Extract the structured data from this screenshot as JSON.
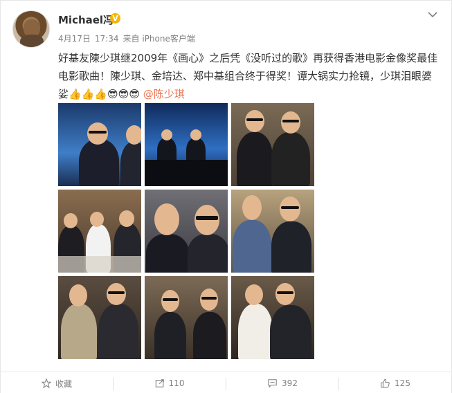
{
  "user": {
    "name": "Michael冯",
    "badge": "V"
  },
  "meta": {
    "date": "4月17日",
    "time": "17:34",
    "source": "来自 iPhone客户端"
  },
  "post": {
    "line1": "好基友陳少琪继2009年《画心》之后凭《没听过的歌》再获得香港电影金像奖最佳",
    "line2": "电影歌曲！陳少琪、金培达、郑中基组合终于得奖！谭大锅实力抢镜，少琪泪眼婆",
    "line3_prefix": "娑",
    "mention": "@陈少琪"
  },
  "photos": [
    {
      "scene": "stage-blue"
    },
    {
      "scene": "stage-screen"
    },
    {
      "scene": "award-two"
    },
    {
      "scene": "dinner-group"
    },
    {
      "scene": "closeup-two"
    },
    {
      "scene": "wall-two"
    },
    {
      "scene": "woman-man"
    },
    {
      "scene": "party-group"
    },
    {
      "scene": "hug"
    }
  ],
  "footer": {
    "favorite_label": "收藏",
    "repost_count": "110",
    "comment_count": "392",
    "like_count": "125"
  },
  "icons": [
    "star-icon",
    "repost-icon",
    "comment-icon",
    "thumb-up-icon",
    "chevron-down-icon",
    "thumbs-up-emoji",
    "sunglasses-emoji"
  ],
  "colors": {
    "mention": "#eb7350",
    "meta": "#808080",
    "badge": "#f7b500"
  }
}
